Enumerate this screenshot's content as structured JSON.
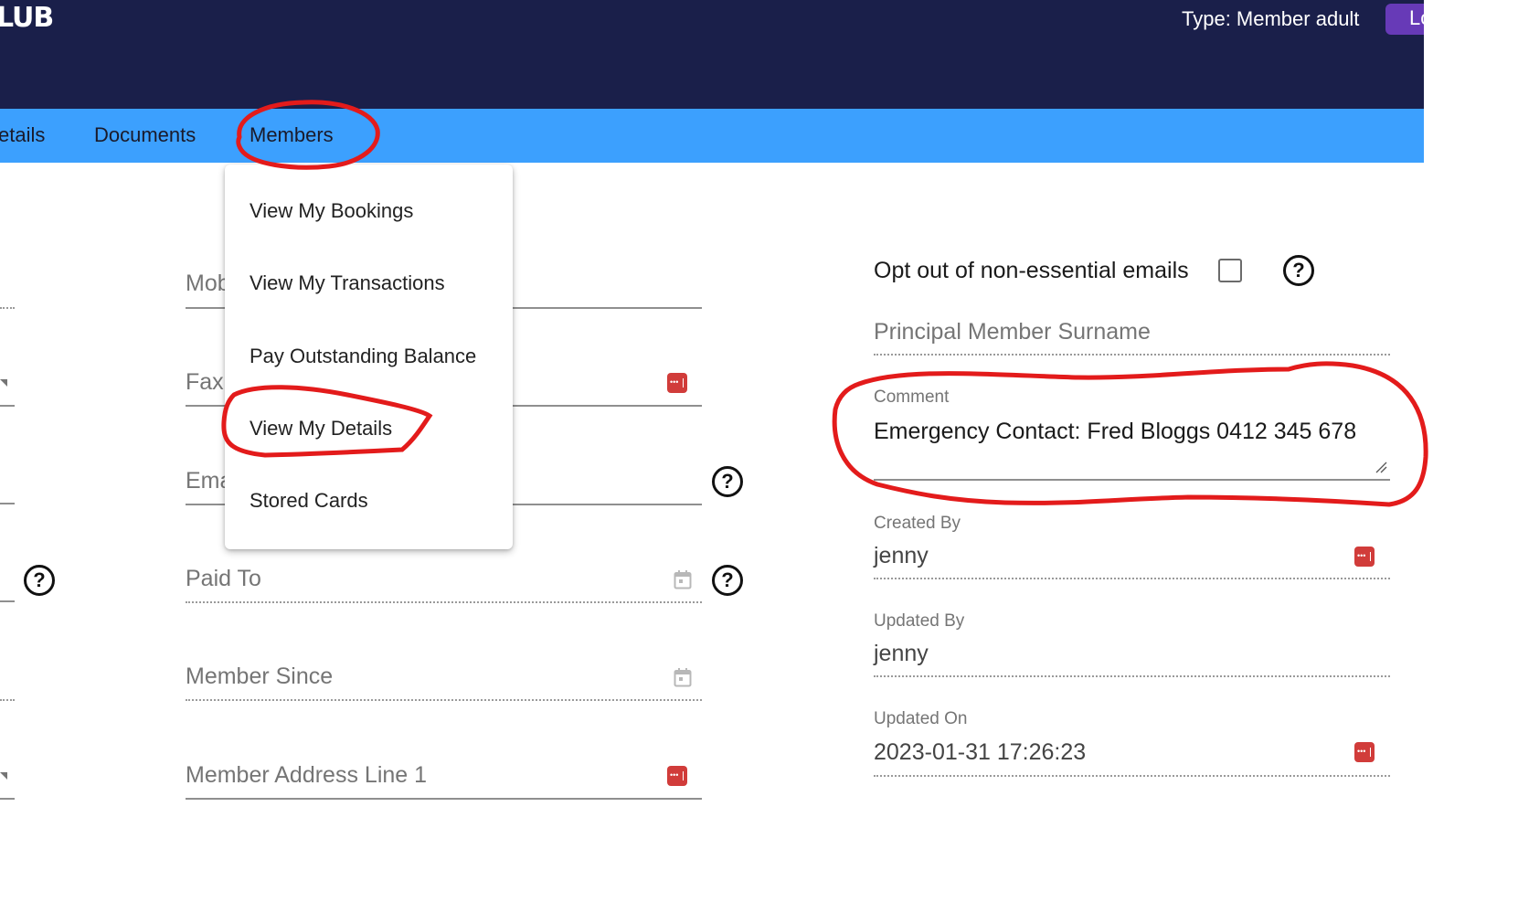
{
  "header": {
    "logo_text": "LUB",
    "user_type": "Type: Member adult",
    "logout_label": "Lo",
    "colors": {
      "header_bg": "#1a1f4a",
      "nav_bg": "#3ca0fe",
      "logout_bg": "#673ab7"
    }
  },
  "nav": {
    "items": [
      {
        "label": "etails"
      },
      {
        "label": "Documents"
      },
      {
        "label": "Members"
      }
    ]
  },
  "members_menu": {
    "items": [
      {
        "label": "View My Bookings"
      },
      {
        "label": "View My Transactions"
      },
      {
        "label": "Pay Outstanding Balance"
      },
      {
        "label": "View My Details"
      },
      {
        "label": "Stored Cards"
      }
    ]
  },
  "middle_fields": {
    "mobile": {
      "label": "Mob"
    },
    "fax": {
      "label": "Fax"
    },
    "email": {
      "label": "Ema"
    },
    "paid_to": {
      "label": "Paid To"
    },
    "member_since": {
      "label": "Member Since"
    },
    "address_line_1": {
      "label": "Member Address Line 1"
    }
  },
  "right_fields": {
    "opt_out": {
      "label": "Opt out of non-essential emails",
      "checked": false
    },
    "principal_surname": {
      "label": "Principal Member Surname"
    },
    "comment": {
      "label": "Comment",
      "value": "Emergency Contact: Fred Bloggs 0412 345 678"
    },
    "created_by": {
      "label": "Created By",
      "value": "jenny"
    },
    "updated_by": {
      "label": "Updated By",
      "value": "jenny"
    },
    "updated_on": {
      "label": "Updated On",
      "value": "2023-01-31 17:26:23"
    }
  },
  "icons": {
    "help": "?",
    "password_manager": "lastpass-icon",
    "calendar": "calendar-icon"
  },
  "annotations": {
    "color": "#e31b1b",
    "circled": [
      "Members",
      "View My Details",
      "Comment"
    ]
  }
}
